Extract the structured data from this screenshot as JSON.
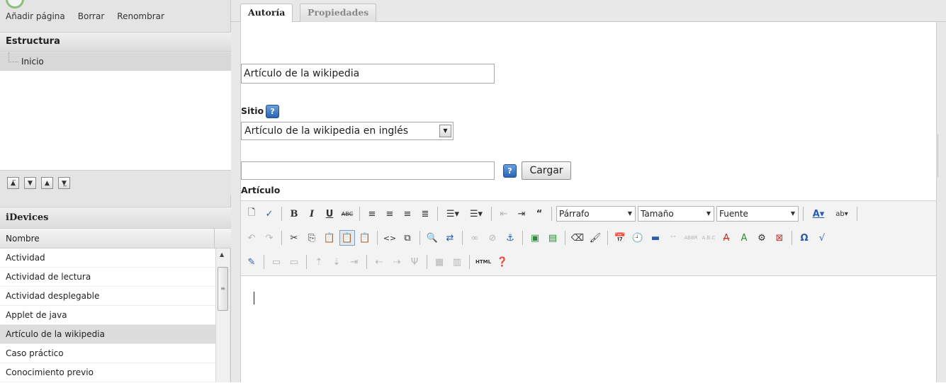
{
  "page_actions": {
    "add": "Añadir página",
    "delete": "Borrar",
    "rename": "Renombrar"
  },
  "structure": {
    "header": "Estructura",
    "items": [
      "Inicio"
    ]
  },
  "move_buttons": [
    "move-top",
    "move-down",
    "move-up",
    "move-bottom"
  ],
  "idevices": {
    "header": "iDevices",
    "column": "Nombre",
    "items": [
      "Actividad",
      "Actividad de lectura",
      "Actividad desplegable",
      "Applet de java",
      "Artículo de la wikipedia",
      "Caso práctico",
      "Conocimiento previo"
    ],
    "selected": "Artículo de la wikipedia"
  },
  "tabs": {
    "authoring": "Autoría",
    "properties": "Propiedades"
  },
  "form": {
    "title_value": "Artículo de la wikipedia",
    "site_label": "Sitio",
    "site_value": "Artículo de la wikipedia en inglés",
    "search_value": "",
    "load_label": "Cargar",
    "article_label": "Artículo",
    "help_glyph": "?"
  },
  "editor": {
    "format_value": "Párrafo",
    "size_value": "Tamaño",
    "font_value": "Fuente",
    "html_label": "HTML"
  }
}
